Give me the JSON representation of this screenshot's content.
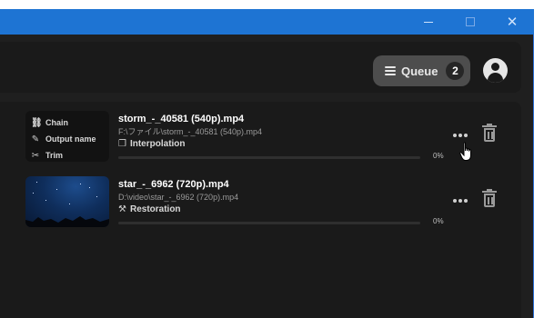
{
  "header": {
    "queue_label": "Queue",
    "queue_count": "2"
  },
  "items": [
    {
      "ops": [
        {
          "icon": "link-icon",
          "label": "Chain"
        },
        {
          "icon": "pencil-icon",
          "label": "Output name"
        },
        {
          "icon": "scissors-icon",
          "label": "Trim"
        }
      ],
      "title": "storm_-_40581 (540p).mp4",
      "path": "F:\\ファイル\\storm_-_40581 (540p).mp4",
      "mode": "Interpolation",
      "mode_icon": "copy-icon",
      "progress": 0,
      "percent": "0%"
    },
    {
      "title": "star_-_6962 (720p).mp4",
      "path": "D:\\video\\star_-_6962 (720p).mp4",
      "mode": "Restoration",
      "mode_icon": "magic-wand-icon",
      "progress": 0,
      "percent": "0%"
    }
  ],
  "colors": {
    "titlebar": "#1e74d3",
    "window_bg": "#1f1f1f",
    "panel_bg": "#1a1a1a",
    "queue_button": "#4d4d4d"
  }
}
